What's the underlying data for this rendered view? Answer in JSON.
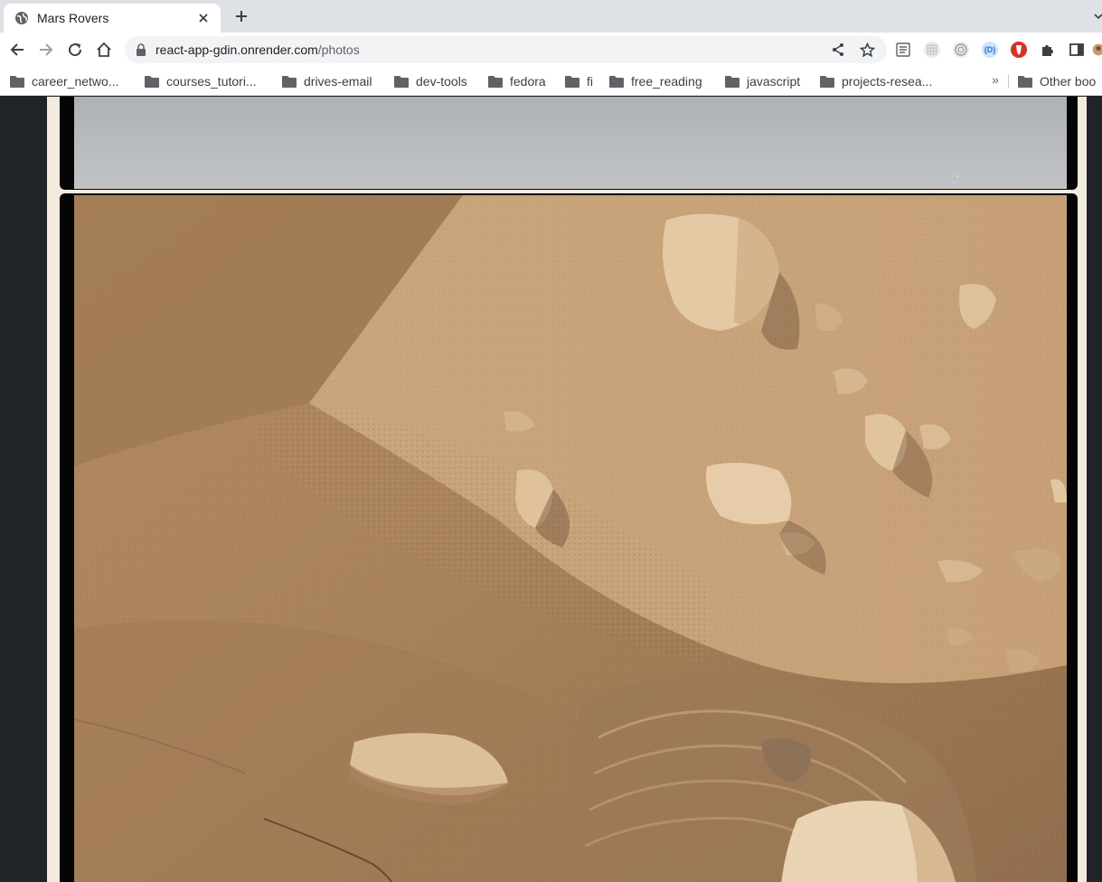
{
  "browser": {
    "tab": {
      "title": "Mars Rovers"
    },
    "address": {
      "host": "react-app-gdin.onrender.com",
      "path": "/photos"
    },
    "bookmarks": [
      "career_netwo...",
      "courses_tutori...",
      "drives-email",
      "dev-tools",
      "fedora",
      "fi",
      "free_reading",
      "javascript",
      "projects-resea..."
    ],
    "bookmarks_overflow": "»",
    "other_bookmarks": "Other boo",
    "extension_badge": "(D)"
  },
  "colors": {
    "page_background": "#202428",
    "content_background": "#f3ecde",
    "photo_frame": "#050505"
  },
  "icons": {
    "tab_favicon": "globe-icon",
    "tab_close": "close-icon",
    "new_tab": "plus-icon",
    "back": "back-arrow-icon",
    "forward": "forward-arrow-icon",
    "reload": "reload-icon",
    "home": "home-icon",
    "lock": "lock-icon",
    "share": "share-icon",
    "bookmark_star": "star-icon",
    "folder": "folder-icon"
  }
}
